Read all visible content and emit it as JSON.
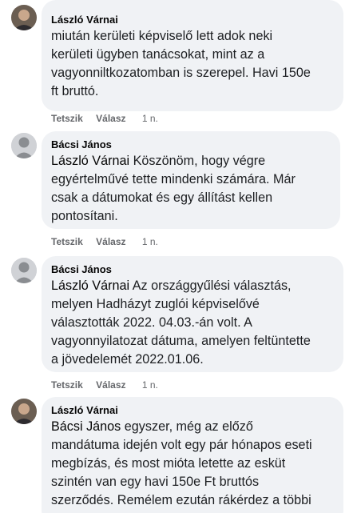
{
  "comments": [
    {
      "author": "László Várnai",
      "mention": "",
      "lines": [
        "miután kerületi képviselő lett adok neki",
        "kerületi ügyben tanácsokat, mint az a",
        "vagyonniltkozatomban is szerepel. Havi 150e",
        "ft bruttó."
      ],
      "like_label": "Tetszik",
      "reply_label": "Válasz",
      "time": "1 n."
    },
    {
      "author": "Bácsi János",
      "mention": "László Várnai",
      "lines": [
        " Köszönöm, hogy végre",
        "egyértelművé tette mindenki számára. Már",
        "csak a dátumokat és egy állítást kellen",
        "pontosítani."
      ],
      "like_label": "Tetszik",
      "reply_label": "Válasz",
      "time": "1 n."
    },
    {
      "author": "Bácsi János",
      "mention": "László Várnai",
      "lines": [
        " Az országgyűlési választás,",
        "melyen Hadházyt zuglói képviselővé",
        "választották 2022. 04.03.-án volt. A",
        "vagyonnyilatozat dátuma, amelyen feltüntette",
        "a jövedelemét 2022.01.06."
      ],
      "like_label": "Tetszik",
      "reply_label": "Válasz",
      "time": "1 n."
    },
    {
      "author": "László Várnai",
      "mention": "Bácsi János",
      "lines": [
        " egyszer, még az előző",
        "mandátuma idején volt egy pár hónapos eseti",
        "megbízás, és most mióta letette az esküt",
        "szintén van egy havi 150e Ft bruttós",
        "szerződés. Remélem ezután rákérdez a többi"
      ],
      "like_label": "",
      "reply_label": "",
      "time": ""
    }
  ]
}
